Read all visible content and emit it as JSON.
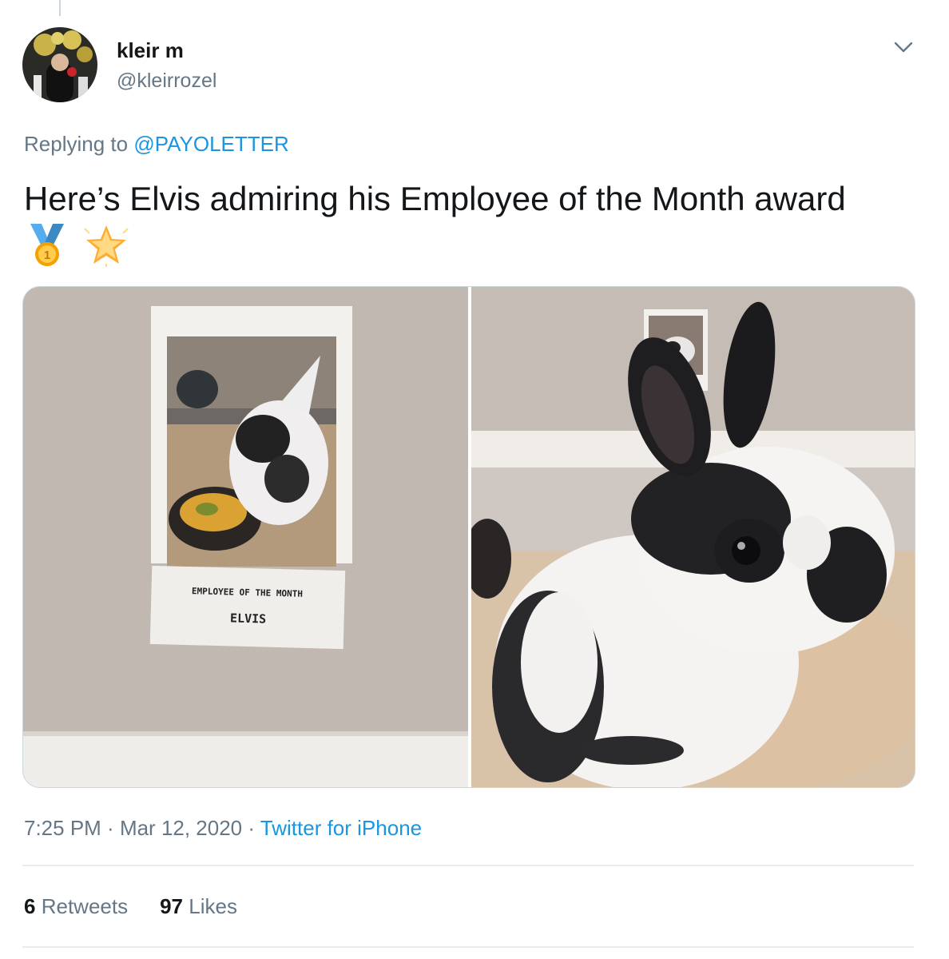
{
  "author": {
    "display_name": "kleir m",
    "handle": "@kleirrozel"
  },
  "reply": {
    "prefix": "Replying to",
    "mention": "@PAYOLETTER"
  },
  "tweet": {
    "text": "Here’s Elvis admiring his Employee of the Month award",
    "emojis": [
      "medal-icon",
      "star-icon"
    ]
  },
  "media": {
    "photo_1": {
      "sign_line_1": "EMPLOYEE OF THE MONTH",
      "sign_line_2": "ELVIS"
    },
    "photo_2": {}
  },
  "meta": {
    "time": "7:25 PM",
    "separator": " · ",
    "date": "Mar 12, 2020",
    "source": "Twitter for iPhone"
  },
  "stats": {
    "retweets_count": "6",
    "retweets_label": "Retweets",
    "likes_count": "97",
    "likes_label": "Likes"
  },
  "colors": {
    "link": "#1b95e0",
    "secondary_text": "#657786",
    "primary_text": "#14171a",
    "divider": "#e6ecf0"
  }
}
